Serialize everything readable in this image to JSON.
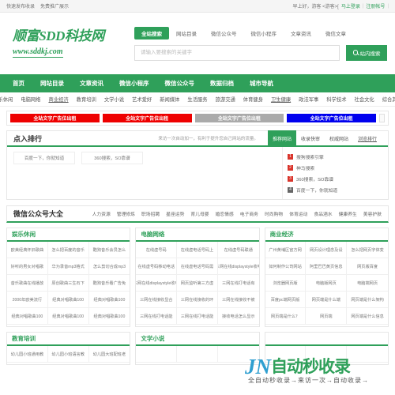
{
  "topbar": {
    "left_links": [
      "快速发布收录",
      "免费推广展示"
    ],
    "greeting": "早上好，游客 <游客>[",
    "login": "马上登录",
    "register": "注册帐号",
    "sep1": "|",
    "sep2": "|"
  },
  "logo": {
    "main": "顺富SDD科技网",
    "sub": "www.sddkj.com"
  },
  "search": {
    "tabs": [
      "全站搜索",
      "网站目录",
      "微信公众号",
      "微信小程序",
      "文章资讯",
      "微信文章"
    ],
    "active_tab": "全站搜索",
    "placeholder": "请输入要搜索的关键字",
    "value": "",
    "button": "站内搜索",
    "button_icon": "search-icon"
  },
  "mainnav": [
    "首页",
    "网站目录",
    "文章资讯",
    "微信小程序",
    "微信公众号",
    "数据归档",
    "城市导航"
  ],
  "subnav": [
    "娱乐休闲",
    "电脑网络",
    "商业经济",
    "教育培训",
    "文学小说",
    "艺术爱好",
    "新闻媒体",
    "生活服务",
    "旅游交通",
    "体育健身",
    "卫生健康",
    "政法军事",
    "科学技术",
    "社会文化",
    "综合其他"
  ],
  "ads": [
    {
      "label": "全站文字广告位出租",
      "color": "#ee0000",
      "text_color": "#ffffff"
    },
    {
      "label": "全站文字广告位出租",
      "color": "#ee0000",
      "text_color": "#ffffff"
    },
    {
      "label": "全站文字广告位出租",
      "color": "#aaaaaa",
      "text_color": "#ffffff"
    },
    {
      "label": "全站文字广告位出租",
      "color": "#0000ee",
      "text_color": "#ffffff"
    }
  ],
  "rank_panel": {
    "title": "点入排行",
    "note": "来访一次自动加一，有利于提升您自己网站的流量。",
    "tabs": [
      "推荐网站",
      "收录快审",
      "权威网站",
      "浏览排行"
    ],
    "active_tab": "推荐网站",
    "cells": [
      "百度一下，你就知道",
      "360搜索，SO靠谱"
    ],
    "list": [
      {
        "num": "1",
        "label": "搜狗搜索引擎",
        "style": "red"
      },
      {
        "num": "2",
        "label": "神马搜索",
        "style": "red"
      },
      {
        "num": "3",
        "label": "360搜索，SO靠谱",
        "style": "red"
      },
      {
        "num": "4",
        "label": "百度一下，你就知道",
        "style": "dark"
      }
    ]
  },
  "wechat": {
    "title": "微信公众号大全",
    "tags": [
      "人力资源",
      "管理修炼",
      "职场招聘",
      "星座运势",
      "育儿母婴",
      "婚恋情感",
      "电子商务",
      "时尚购物",
      "体育运动",
      "食品酒水",
      "健康养生",
      "美容护肤"
    ]
  },
  "cards": [
    {
      "title": "娱乐休闲",
      "items": [
        "欧美经典怀旧歌曲",
        "怎么把百度的音乐",
        "酷狗音乐会员怎么",
        "好听的男女对唱歌",
        "华为录音mp3格式",
        "怎么剪切合成mp3",
        "音乐歌曲在线播放",
        "原创歌曲三生石下",
        "酷狗音乐看广告免",
        "2000年欧美流行",
        "经典对唱歌曲100",
        "经典对唱歌曲100",
        "经典对唱歌曲100",
        "经典对唱歌曲100",
        "经典对唱歌曲100"
      ]
    },
    {
      "title": "电脑网络",
      "items": [
        "在线虚号码",
        "在线虚电话号码上",
        "在线虚号码联通",
        "在线虚号码移动电话",
        "在线虚电话号码需",
        "三网在线displaystyle收电",
        "三网在线displaystyle收电",
        "网页监听第三方虚",
        "三网在线打电话有",
        "三网在线接收显合",
        "三网在线接收的环",
        "三网在线接收不被",
        "三网在线打电话能",
        "三网在线打电话能",
        "接收电话怎么显示"
      ]
    },
    {
      "title": "商业经济",
      "items": [
        "广州黄埔区官方网",
        "网页设计理念及设",
        "怎么把网页字体变",
        "如何制作公司网站",
        "阿里巴巴黄页信息",
        "网页版百度",
        "浏览器网页版",
        "电脑版网页",
        "电脑端网页",
        "百度pc端网页版",
        "网页端是什么端",
        "网页端是什么架构",
        "网页端是什么？",
        "网页端",
        "网页端是什么信息"
      ]
    }
  ],
  "cards2": [
    {
      "title": "教育培训",
      "items": [
        "幼儿园小班通用教",
        "幼儿园小班语言教",
        "幼儿园大班配班老"
      ]
    },
    {
      "title": "文学小说",
      "items": [
        "",
        "",
        ""
      ]
    },
    {
      "title": "",
      "items": [
        "",
        "",
        ""
      ]
    }
  ],
  "watermark": {
    "logo": "JN",
    "text": "自动秒收录",
    "sub": "全自动秒收录→来访一次→自动收录→"
  }
}
